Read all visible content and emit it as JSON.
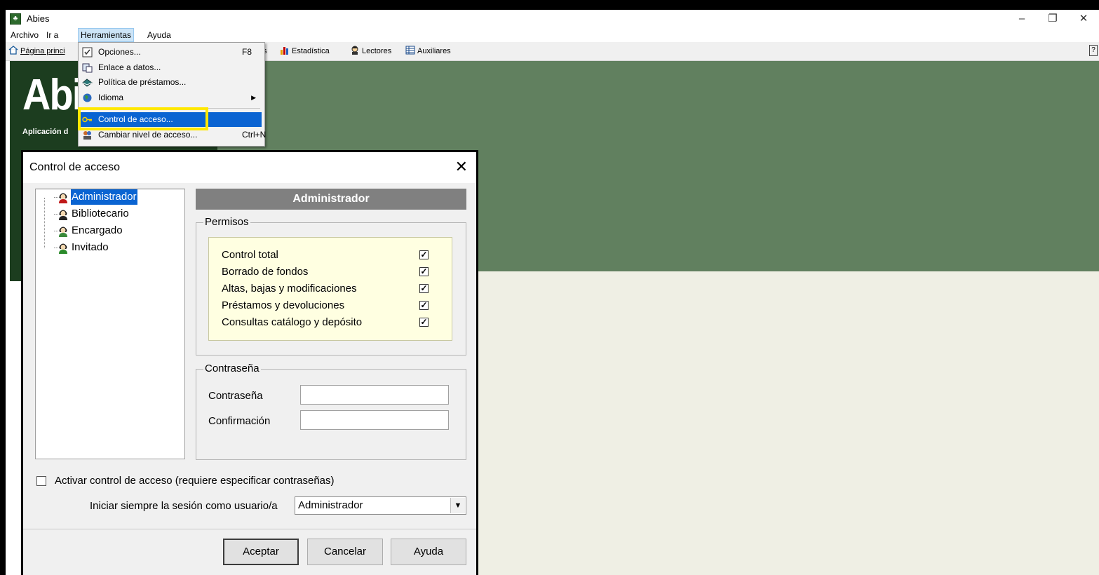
{
  "window": {
    "title": "Abies",
    "minimize": "–",
    "restore": "❐",
    "close": "✕"
  },
  "menubar": [
    "Archivo",
    "Ir a",
    "Herramientas",
    "Ayuda"
  ],
  "toolbar": {
    "home_visible": "Página princi",
    "partial": "s",
    "estadistica": "Estadística",
    "lectores": "Lectores",
    "auxiliares": "Auxiliares"
  },
  "background": {
    "logo": "Abi",
    "subtitle": "Aplicación d"
  },
  "dropdown": {
    "items": [
      {
        "label": "Opciones...",
        "shortcut": "F8"
      },
      {
        "label": "Enlace a datos...",
        "shortcut": ""
      },
      {
        "label": "Política de préstamos...",
        "shortcut": ""
      },
      {
        "label": "Idioma",
        "shortcut": ""
      },
      {
        "label": "Control de acceso...",
        "shortcut": ""
      },
      {
        "label": "Cambiar nivel de acceso...",
        "shortcut": "Ctrl+N"
      }
    ]
  },
  "dialog": {
    "title": "Control de acceso",
    "users": [
      "Administrador",
      "Bibliotecario",
      "Encargado",
      "Invitado"
    ],
    "selected_user": "Administrador",
    "permisos_label": "Permisos",
    "permissions": [
      {
        "label": "Control total",
        "checked": true
      },
      {
        "label": "Borrado de fondos",
        "checked": true
      },
      {
        "label": "Altas, bajas y modificaciones",
        "checked": true
      },
      {
        "label": "Préstamos y devoluciones",
        "checked": true
      },
      {
        "label": "Consultas catálogo y depósito",
        "checked": true
      }
    ],
    "password_group": "Contraseña",
    "password_label": "Contraseña",
    "password_value": "",
    "confirm_label": "Confirmación",
    "confirm_value": "",
    "activate_label": "Activar control de acceso (requiere especificar contraseñas)",
    "activate_checked": false,
    "start_session_label": "Iniciar siempre la sesión como usuario/a",
    "start_session_value": "Administrador",
    "buttons": {
      "ok": "Aceptar",
      "cancel": "Cancelar",
      "help": "Ayuda"
    }
  },
  "colors": {
    "accent": "#0a64d2",
    "highlight_box": "#ffe800",
    "green_header": "#61805f",
    "dark_green": "#1c3d1f",
    "beige": "#efefe4"
  }
}
